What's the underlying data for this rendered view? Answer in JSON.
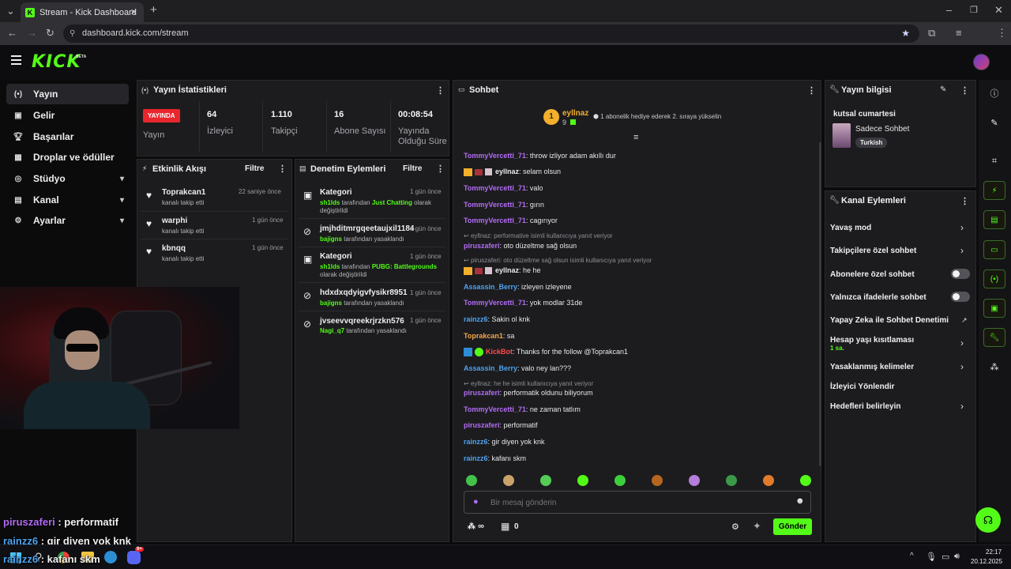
{
  "browser": {
    "tab_title": "Stream - Kick Dashboard",
    "url": "dashboard.kick.com/stream"
  },
  "header": {
    "logo": "KICK",
    "beta": "BETA"
  },
  "sidebar": {
    "items": [
      {
        "label": "Yayın",
        "icon": "broadcast-icon"
      },
      {
        "label": "Gelir",
        "icon": "revenue-icon"
      },
      {
        "label": "Başarılar",
        "icon": "trophy-icon"
      },
      {
        "label": "Droplar ve ödüller",
        "icon": "gift-icon"
      },
      {
        "label": "Stüdyo",
        "icon": "studio-icon"
      },
      {
        "label": "Kanal",
        "icon": "channel-icon"
      },
      {
        "label": "Ayarlar",
        "icon": "gear-icon"
      }
    ]
  },
  "stats": {
    "title": "Yayın İstatistikleri",
    "live_badge": "YAYINDA",
    "live_label": "Yayın",
    "viewers": "64",
    "viewers_label": "İzleyici",
    "followers": "1.110",
    "followers_label": "Takipçi",
    "subs": "16",
    "subs_label": "Abone Sayısı",
    "duration": "00:08:54",
    "duration_label1": "Yayında",
    "duration_label2": "Olduğu Süre"
  },
  "activity": {
    "title": "Etkinlik Akışı",
    "filter": "Filtre",
    "items": [
      {
        "name": "Toprakcan1",
        "sub": "kanalı takip etti",
        "time": "22 saniye önce"
      },
      {
        "name": "warphi",
        "sub": "kanalı takip etti",
        "time": "1 gün önce"
      },
      {
        "name": "kbnqq",
        "sub": "kanalı takip etti",
        "time": "1 gün önce"
      }
    ]
  },
  "moderation": {
    "title": "Denetim Eylemleri",
    "filter": "Filtre",
    "items": [
      {
        "name": "Kategori",
        "time": "1 gün önce",
        "actor": "sh1lds",
        "mid": " tarafından ",
        "target": "Just Chatting",
        "tail": " olarak",
        "line2": "değiştirildi"
      },
      {
        "name": "jmjhditmrgqeetaujxil1184",
        "time": "1 gün önce",
        "actor": "bajigns",
        "mid": " tarafından yasaklandı"
      },
      {
        "name": "Kategori",
        "time": "1 gün önce",
        "actor": "sh1lds",
        "mid": " tarafından ",
        "target": "PUBG: Battlegrounds",
        "line2": "olarak değiştirildi"
      },
      {
        "name": "hdxdxqdyigvfysikr8951",
        "time": "1 gün önce",
        "actor": "bajigns",
        "mid": " tarafından yasaklandı"
      },
      {
        "name": "jvseevvqreekrjrzkn576",
        "time": "1 gün önce",
        "actor": "Nagi_q7",
        "mid": " tarafından yasaklandı"
      }
    ]
  },
  "chat": {
    "title": "Sohbet",
    "top_gifter": {
      "rank": "1",
      "name": "eyllnaz",
      "count": "9"
    },
    "promo": "1 abonelik hediye ederek 2. sıraya yükselin",
    "messages": [
      {
        "user": "TommyVercetti_71",
        "color": "purple",
        "text": ": throw izliyor adam akıllı dur"
      },
      {
        "user": "eyllnaz",
        "color": "white",
        "text": ": selam olsun",
        "badges": true
      },
      {
        "user": "TommyVercetti_71",
        "color": "purple",
        "text": ": valo"
      },
      {
        "user": "TommyVercetti_71",
        "color": "purple",
        "text": ": gırın"
      },
      {
        "user": "TommyVercetti_71",
        "color": "purple",
        "text": ": cagırıyor"
      },
      {
        "reply": "eyllnaz: performative isimli kullanıcıya yanıt veriyor"
      },
      {
        "user": "piruszaferi",
        "color": "purple",
        "text": ": oto düzeltme sağ olsun"
      },
      {
        "reply": "piruszaferi: oto düzeltme sağ olsun isimli kullanıcıya yanıt veriyor"
      },
      {
        "user": "eyllnaz",
        "color": "white",
        "text": ": he he",
        "badges": true
      },
      {
        "user": "Assassin_Berry",
        "color": "blue",
        "text": ": izleyen izleyene"
      },
      {
        "user": "TommyVercetti_71",
        "color": "purple",
        "text": ": yok modlar 31de"
      },
      {
        "user": "rainzz6",
        "color": "blue",
        "text": ": Sakin ol knk"
      },
      {
        "user": "Toprakcan1",
        "color": "orange",
        "text": ": sa"
      },
      {
        "user": "KickBot",
        "color": "red",
        "text": ": Thanks for the follow @Toprakcan1",
        "bot": true
      },
      {
        "user": "Assassin_Berry",
        "color": "blue",
        "text": ": valo ney lan???"
      },
      {
        "reply": "eyllnaz: he he isimli kullanıcıya yanıt veriyor"
      },
      {
        "user": "piruszaferi",
        "color": "purple",
        "text": ": performatik oldunu biliyorum"
      },
      {
        "user": "TommyVercetti_71",
        "color": "purple",
        "text": ": ne zaman tatlım"
      },
      {
        "user": "piruszaferi",
        "color": "purple",
        "text": ": performatif"
      },
      {
        "user": "rainzz6",
        "color": "blue",
        "text": ": gir diyen yok knk"
      },
      {
        "user": "rainzz6",
        "color": "blue",
        "text": ": kafanı skm"
      }
    ],
    "emote_colors": [
      "#43c24a",
      "#c9a36a",
      "#55cc55",
      "#53fc18",
      "#3ccf3c",
      "#b5651d",
      "#b57edc",
      "#3a9a4a",
      "#e07b2a",
      "#53fc18"
    ],
    "input_placeholder": "Bir mesaj gönderin",
    "infinity": "∞",
    "points": "0",
    "send": "Gönder"
  },
  "stream_info": {
    "title": "Yayın bilgisi",
    "stream_title": "kutsal cumartesi",
    "category": "Sadece Sohbet",
    "tag": "Turkish"
  },
  "channel_actions": {
    "title": "Kanal Eylemleri",
    "items": [
      {
        "label": "Yavaş mod",
        "kind": "chev"
      },
      {
        "label": "Takipçilere özel sohbet",
        "kind": "chev"
      },
      {
        "label": "Abonelere özel sohbet",
        "kind": "toggle"
      },
      {
        "label": "Yalnızca ifadelerle sohbet",
        "kind": "toggle"
      },
      {
        "label": "Yapay Zeka ile Sohbet Denetimi",
        "kind": "ext"
      },
      {
        "label": "Hesap yaşı kısıtlaması",
        "sub": "1 sa.",
        "kind": "chev"
      },
      {
        "label": "Yasaklanmış kelimeler",
        "kind": "chev"
      },
      {
        "label": "İzleyici Yönlendir",
        "kind": "none"
      },
      {
        "label": "Hedefleri belirleyin",
        "kind": "chev"
      }
    ]
  },
  "overlay": {
    "lines": [
      {
        "user": "piruszaferi",
        "text": " : performatif",
        "color": "#b36cf5"
      },
      {
        "user": "rainzz6",
        "text": " : gir diyen yok knk",
        "color": "#4ea3f0"
      },
      {
        "user": "rainzz6",
        "text": " : kafanı skm",
        "color": "#4ea3f0"
      }
    ]
  },
  "taskbar": {
    "time": "22:17",
    "date": "20.12.2025",
    "badge": "9+"
  },
  "colors": {
    "accent": "#53fc18",
    "live": "#e8262c",
    "panel": "#1c1c1f"
  }
}
